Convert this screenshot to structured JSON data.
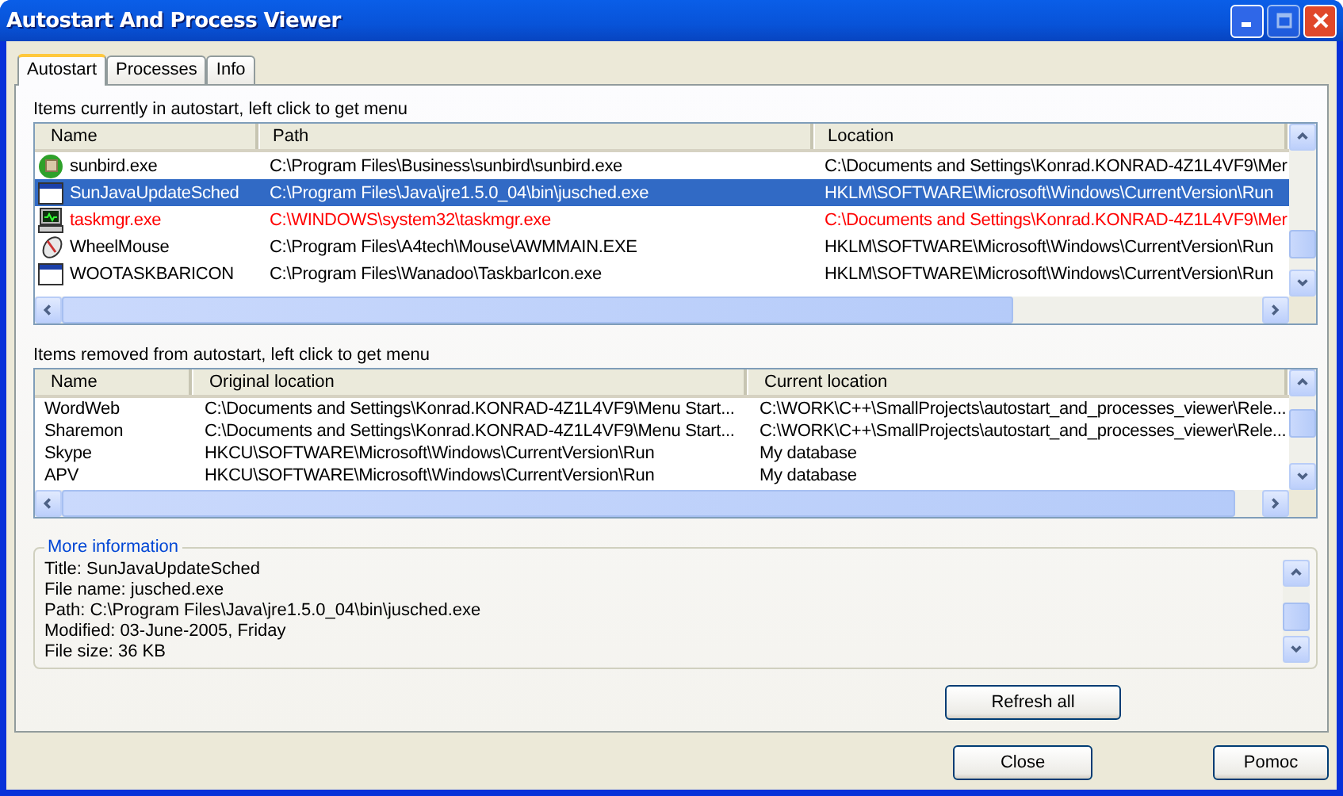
{
  "window": {
    "title": "Autostart And Process Viewer"
  },
  "tabs": [
    {
      "label": "Autostart",
      "selected": true
    },
    {
      "label": "Processes",
      "selected": false
    },
    {
      "label": "Info",
      "selected": false
    }
  ],
  "autostart": {
    "caption": "Items currently in autostart, left click to get menu",
    "columns": [
      "Name",
      "Path",
      "Location"
    ],
    "rows": [
      {
        "kind": "globe",
        "name": "sunbird.exe",
        "path": "C:\\Program Files\\Business\\sunbird\\sunbird.exe",
        "location": "C:\\Documents and Settings\\Konrad.KONRAD-4Z1L4VF9\\Mer",
        "selected": false,
        "color": "#000000"
      },
      {
        "kind": "window",
        "name": "SunJavaUpdateSched",
        "path": "C:\\Program Files\\Java\\jre1.5.0_04\\bin\\jusched.exe",
        "location": "HKLM\\SOFTWARE\\Microsoft\\Windows\\CurrentVersion\\Run",
        "selected": true
      },
      {
        "kind": "computer",
        "name": "taskmgr.exe",
        "path": "C:\\WINDOWS\\system32\\taskmgr.exe",
        "location": "C:\\Documents and Settings\\Konrad.KONRAD-4Z1L4VF9\\Mer",
        "selected": false,
        "color": "#ff0000"
      },
      {
        "kind": "mouse",
        "name": "WheelMouse",
        "path": "C:\\Program Files\\A4tech\\Mouse\\AWMMAIN.EXE",
        "location": "HKLM\\SOFTWARE\\Microsoft\\Windows\\CurrentVersion\\Run",
        "selected": false,
        "color": "#000000"
      },
      {
        "kind": "window",
        "name": "WOOTASKBARICON",
        "path": "C:\\Program Files\\Wanadoo\\TaskbarIcon.exe",
        "location": "HKLM\\SOFTWARE\\Microsoft\\Windows\\CurrentVersion\\Run",
        "selected": false,
        "color": "#000000"
      }
    ]
  },
  "removed": {
    "caption": "Items removed from autostart, left click to get menu",
    "columns": [
      "Name",
      "Original location",
      "Current location"
    ],
    "rows": [
      {
        "name": "WordWeb",
        "original": "C:\\Documents and Settings\\Konrad.KONRAD-4Z1L4VF9\\Menu Start...",
        "current": "C:\\WORK\\C++\\SmallProjects\\autostart_and_processes_viewer\\Rele..."
      },
      {
        "name": "Sharemon",
        "original": "C:\\Documents and Settings\\Konrad.KONRAD-4Z1L4VF9\\Menu Start...",
        "current": "C:\\WORK\\C++\\SmallProjects\\autostart_and_processes_viewer\\Rele..."
      },
      {
        "name": "Skype",
        "original": "HKCU\\SOFTWARE\\Microsoft\\Windows\\CurrentVersion\\Run",
        "current": "My database"
      },
      {
        "name": "APV",
        "original": "HKCU\\SOFTWARE\\Microsoft\\Windows\\CurrentVersion\\Run",
        "current": "My database"
      }
    ]
  },
  "more_information": {
    "legend": "More information",
    "lines": [
      "Title: SunJavaUpdateSched",
      "File name: jusched.exe",
      "Path: C:\\Program Files\\Java\\jre1.5.0_04\\bin\\jusched.exe",
      "Modified: 03-June-2005, Friday",
      "File size: 36 KB"
    ]
  },
  "refresh_button": "Refresh all",
  "buttons": [
    "Close",
    "Pomoc"
  ]
}
